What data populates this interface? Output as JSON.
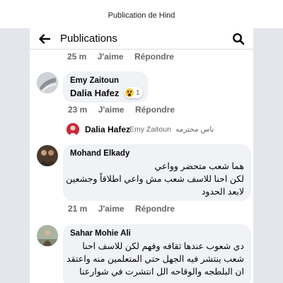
{
  "window": {
    "title": "Publication de Hind"
  },
  "header": {
    "title": "Publications"
  },
  "actions": {
    "like": "J'aime",
    "reply": "Répondre"
  },
  "comments": [
    {
      "time": "25 m"
    },
    {
      "author": "Emy Zaitoun",
      "tagged": "Dalia Hafez",
      "time": "23 m",
      "reaction_count": "1",
      "reaction": "wow"
    },
    {
      "author": "Mohand Elkady",
      "lines": [
        "هما شعب متحضر وواعي",
        "لكن احنا للاسف شعب مش واعي اطلاقاً وجشعين",
        "لابعد الحدود"
      ],
      "time": "21 m"
    },
    {
      "author": "Sahar Mohie Ali",
      "lines": [
        "دي شعوب عندها ثقافه وفهم لكن للاسف احنا",
        "شعب ينتشر فيه الجهل حتي المتعلمين منه واعتقد",
        "ان البلطجه والوقاحه الل انتشرت في شوارعنا"
      ]
    }
  ],
  "reply_preview": {
    "author": "Dalia Hafez",
    "tag": "Emy Zaitoun",
    "text": "ناس محترمه"
  },
  "colors": {
    "avatar_reply": "#c62c3b",
    "reaction_wow": "#f7c737",
    "bubble": "#f0f2f5",
    "meta": "#65676b"
  },
  "icons": {
    "back": "arrow-left-icon",
    "search": "search-icon",
    "reaction": "wow-reaction-icon"
  }
}
